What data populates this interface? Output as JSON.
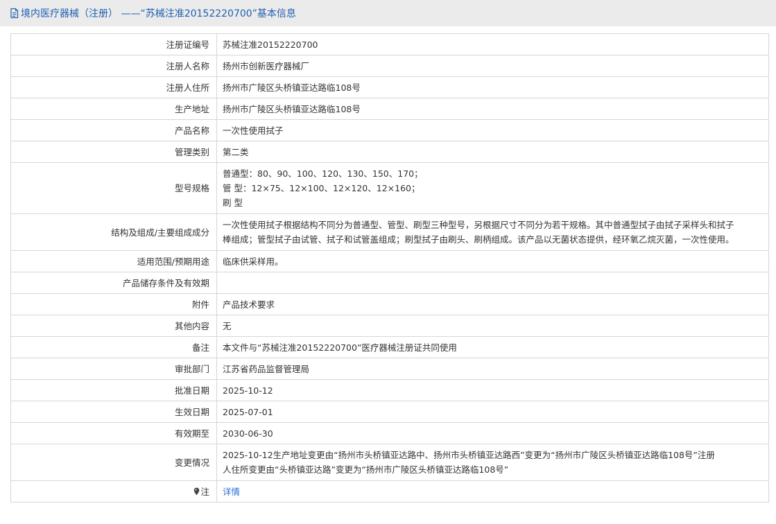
{
  "header": {
    "title": "境内医疗器械（注册） ——“苏械注准20152220700”基本信息"
  },
  "rows": [
    {
      "label": "注册证编号",
      "value": "苏械注准20152220700"
    },
    {
      "label": "注册人名称",
      "value": "扬州市创新医疗器械厂"
    },
    {
      "label": "注册人住所",
      "value": "扬州市广陵区头桥镇亚达路临108号"
    },
    {
      "label": "生产地址",
      "value": "扬州市广陵区头桥镇亚达路临108号"
    },
    {
      "label": "产品名称",
      "value": "一次性使用拭子"
    },
    {
      "label": "管理类别",
      "value": "第二类"
    },
    {
      "label": "型号规格",
      "lines": [
        "普通型：80、90、100、120、130、150、170；",
        "管 型：12×75、12×100、12×120、12×160；",
        "刷 型"
      ]
    },
    {
      "label": "结构及组成/主要组成成分",
      "lines": [
        "一次性使用拭子根据结构不同分为普通型、管型、刷型三种型号，另根据尺寸不同分为若干规格。其中普通型拭子由拭子采样头和拭子",
        "棒组成；管型拭子由试管、拭子和试管盖组成；刷型拭子由刷头、刷柄组成。该产品以无菌状态提供，经环氧乙烷灭菌，一次性使用。"
      ]
    },
    {
      "label": "适用范围/预期用途",
      "value": "临床供采样用。"
    },
    {
      "label": "产品储存条件及有效期",
      "value": ""
    },
    {
      "label": "附件",
      "value": "产品技术要求"
    },
    {
      "label": "其他内容",
      "value": "无"
    },
    {
      "label": "备注",
      "value": "本文件与“苏械注准20152220700”医疗器械注册证共同使用"
    },
    {
      "label": "审批部门",
      "value": "江苏省药品监督管理局"
    },
    {
      "label": "批准日期",
      "value": "2025-10-12"
    },
    {
      "label": "生效日期",
      "value": "2025-07-01"
    },
    {
      "label": "有效期至",
      "value": "2030-06-30"
    },
    {
      "label": "变更情况",
      "lines": [
        "2025-10-12生产地址变更由“扬州市头桥镇亚达路中、扬州市头桥镇亚达路西”变更为“扬州市广陵区头桥镇亚达路临108号”注册",
        "人住所变更由“头桥镇亚达路”变更为“扬州市广陵区头桥镇亚达路临108号”"
      ]
    },
    {
      "label": "注",
      "value": "详情",
      "icon": "location-pin-icon"
    }
  ],
  "colors": {
    "header_bg": "#ebebeb",
    "header_text": "#1f5fb0",
    "link": "#2a6fd6",
    "border": "#d6d6d6"
  }
}
